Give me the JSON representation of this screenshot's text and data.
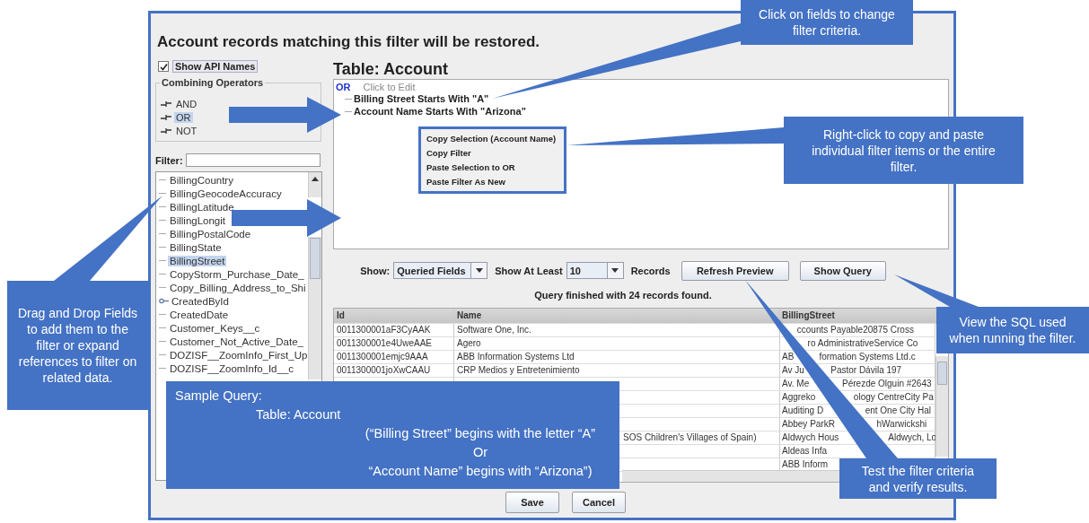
{
  "dialog": {
    "title": "Account records matching this filter will be restored.",
    "show_api_names": {
      "label": "Show API Names",
      "checked": true
    },
    "combining_operators": {
      "title": "Combining Operators",
      "items": [
        {
          "label": "AND",
          "selected": false
        },
        {
          "label": "OR",
          "selected": true
        },
        {
          "label": "NOT",
          "selected": false
        }
      ]
    },
    "filter": {
      "label": "Filter:"
    },
    "fields": [
      {
        "label": "BillingCountry",
        "kind": "field",
        "selected": false
      },
      {
        "label": "BillingGeocodeAccuracy",
        "kind": "field",
        "selected": false
      },
      {
        "label": "BillingLatitude",
        "kind": "field",
        "selected": false
      },
      {
        "label": "BillingLongit",
        "kind": "field",
        "selected": false
      },
      {
        "label": "BillingPostalCode",
        "kind": "field",
        "selected": false
      },
      {
        "label": "BillingState",
        "kind": "field",
        "selected": false
      },
      {
        "label": "BillingStreet",
        "kind": "field",
        "selected": true
      },
      {
        "label": "CopyStorm_Purchase_Date_",
        "kind": "field",
        "selected": false
      },
      {
        "label": "Copy_Billing_Address_to_Shi",
        "kind": "field",
        "selected": false
      },
      {
        "label": "CreatedById",
        "kind": "reference",
        "selected": false
      },
      {
        "label": "CreatedDate",
        "kind": "field",
        "selected": false
      },
      {
        "label": "Customer_Keys__c",
        "kind": "field",
        "selected": false
      },
      {
        "label": "Customer_Not_Active_Date_",
        "kind": "field",
        "selected": false
      },
      {
        "label": "DOZISF__ZoomInfo_First_Up",
        "kind": "field",
        "selected": false
      },
      {
        "label": "DOZISF__ZoomInfo_Id__c",
        "kind": "field",
        "selected": false
      }
    ],
    "table_title": "Table: Account",
    "filter_tree": {
      "operator": "OR",
      "hint": "Click to Edit",
      "children": [
        {
          "label": "Billing Street Starts With \"A\""
        },
        {
          "label": "Account Name Starts With \"Arizona\""
        }
      ]
    },
    "context_menu": [
      "Copy Selection (Account Name)",
      "Copy Filter",
      "Paste Selection to OR",
      "Paste Filter As New"
    ],
    "show": {
      "label": "Show:",
      "value": "Queried Fields"
    },
    "show_at_least": {
      "label": "Show At Least",
      "value": "10",
      "suffix": "Records"
    },
    "actions": [
      "Refresh Preview",
      "Show Query"
    ],
    "status": "Query finished with 24 records found.",
    "table": {
      "columns": [
        "Id",
        "Name",
        "BillingStreet"
      ],
      "rows": [
        {
          "id": "0011300001aF3CyAAK",
          "name": "Software One, Inc.",
          "street": {
            "after": "ccounts Payable20875 Cross"
          }
        },
        {
          "id": "0011300001e4UweAAE",
          "name": "Agero",
          "street": {
            "after": "ro AdministrativeService Co"
          }
        },
        {
          "id": "0011300001emjc9AAA",
          "name": "ABB Information Systems Ltd",
          "street": {
            "before": "AB",
            "after": "formation Systems Ltd.c"
          }
        },
        {
          "id": "0011300001joXwCAAU",
          "name": "CRP Medios y Entretenimiento",
          "street": {
            "before": "Av Ju",
            "after": "Pastor Dávila 197"
          }
        },
        {
          "street": {
            "before": "Av. Me",
            "after": "Pérezde Olguin #2643"
          }
        },
        {
          "street": {
            "before": "Aggreko",
            "after": "ology CentreCity Pa"
          }
        },
        {
          "street": {
            "before": "Auditing D",
            "after": "ent One City Hal"
          }
        },
        {
          "street": {
            "before": "Abbey ParkR",
            "after": "hWarwickshi"
          }
        },
        {
          "name": "SOS Children's Villages of Spain)",
          "street": {
            "before": "Aldwych Hous",
            "after": "Aldwych, Lo"
          }
        },
        {
          "street": {
            "before": "Aldeas Infa"
          }
        },
        {
          "street": {
            "before": "ABB Inform"
          }
        }
      ]
    },
    "footer_buttons": [
      "Save",
      "Cancel"
    ]
  },
  "callouts": [
    {
      "text": "Click on fields to change filter criteria."
    },
    {
      "text": "Right-click to copy and paste individual filter items or the entire filter."
    },
    {
      "text": "View the SQL used when running the filter."
    },
    {
      "text": "Test the filter criteria and verify results."
    },
    {
      "text": "Drag and Drop Fields to add them to the filter or expand references to filter on related data."
    }
  ],
  "sample_query": {
    "heading": "Sample Query:",
    "table": "Table: Account",
    "lines": [
      "(“Billing Street” begins with the letter “A”",
      "Or",
      "“Account Name” begins with “Arizona”)"
    ]
  }
}
